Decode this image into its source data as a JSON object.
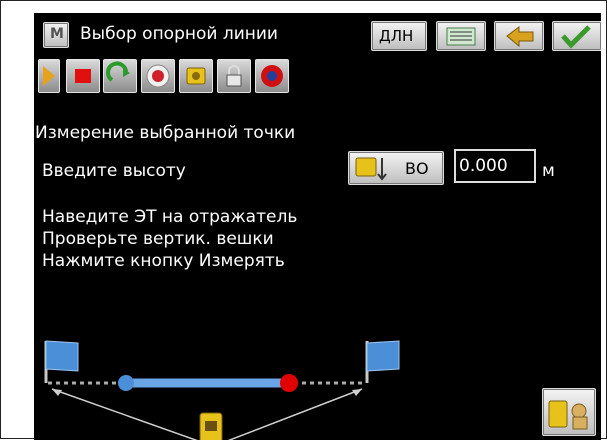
{
  "title_bar": {
    "title": "Выбор опорной линии",
    "mode_label": "ДЛН",
    "app_icon": "M"
  },
  "toolbar": {
    "icons": [
      "play-icon",
      "stop-icon",
      "redo-icon",
      "target-icon",
      "prism-icon",
      "lock-icon",
      "record-icon"
    ]
  },
  "main": {
    "heading": "Измерение выбранной точки",
    "height_prompt": "Введите высоту",
    "target_button_label": "ВО",
    "height_value": "0.000",
    "height_unit": "м",
    "instructions": [
      "Наведите ЭТ на отражатель",
      "Проверьте вертик. вешки",
      "Нажмите кнопку Измерять"
    ]
  },
  "colors": {
    "background": "#000000",
    "flag": "#4a8fd8",
    "point_blue": "#4a8fd8",
    "point_red": "#e00000",
    "prism_yellow": "#e6c21a"
  }
}
